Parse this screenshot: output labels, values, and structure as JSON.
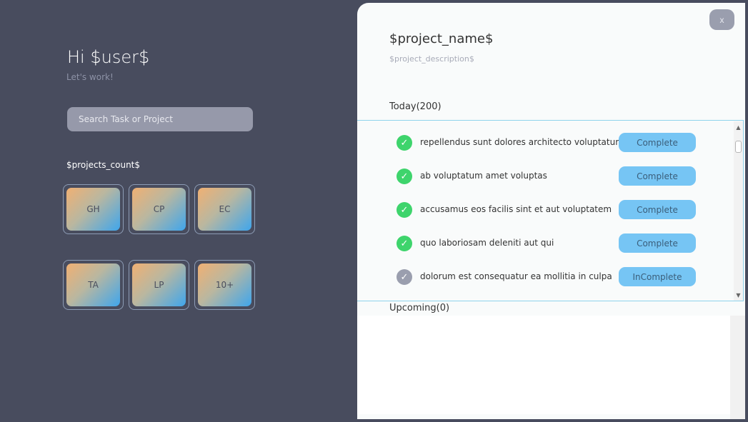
{
  "sidebar": {
    "greeting": "Hi $user$",
    "subgreeting": "Let's work!",
    "search_placeholder": "Search Task or Project",
    "projects_count": "$projects_count$",
    "projects": [
      {
        "label": "GH"
      },
      {
        "label": "CP"
      },
      {
        "label": "EC"
      },
      {
        "label": "TA"
      },
      {
        "label": "LP"
      },
      {
        "label": "10+"
      }
    ]
  },
  "panel": {
    "close_label": "x",
    "project_name": "$project_name$",
    "project_description": "$project_description$",
    "today_label": "Today(200)",
    "upcoming_label": "Upcoming(0)",
    "tasks": [
      {
        "text": "repellendus sunt dolores architecto voluptatum",
        "status": "Complete",
        "done": true
      },
      {
        "text": "ab voluptatum amet voluptas",
        "status": "Complete",
        "done": true
      },
      {
        "text": "accusamus eos facilis sint et aut voluptatem",
        "status": "Complete",
        "done": true
      },
      {
        "text": "quo laboriosam deleniti aut qui",
        "status": "Complete",
        "done": true
      },
      {
        "text": "dolorum est consequatur ea mollitia in culpa",
        "status": "InComplete",
        "done": false
      }
    ]
  },
  "colors": {
    "background": "#484c5e",
    "panel": "#f9fbfb",
    "accent_button": "#76c5f4",
    "check_done": "#3ed46c",
    "check_todo": "#9a9eae"
  },
  "icons": {
    "check": "check-icon",
    "scroll_up": "chevron-up-icon",
    "scroll_down": "chevron-down-icon"
  }
}
